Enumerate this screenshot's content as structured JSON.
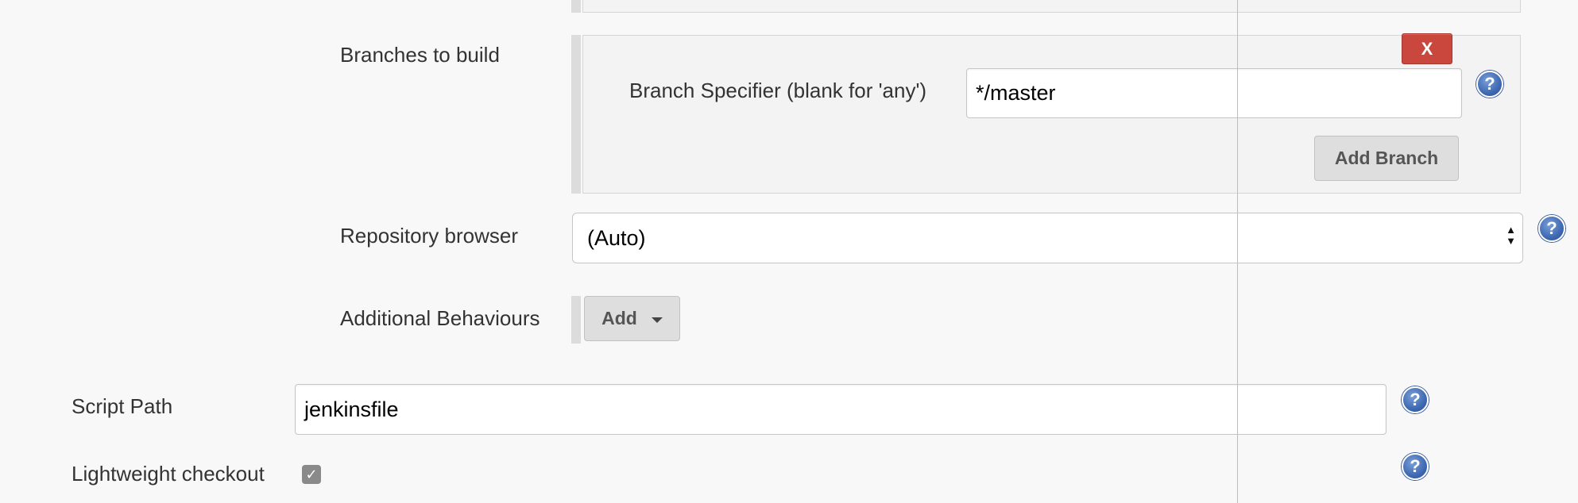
{
  "scm_git": {
    "branches": {
      "label": "Branches to build",
      "delete_label": "X",
      "specifier_label": "Branch Specifier (blank for 'any')",
      "specifier_value": "*/master",
      "add_branch_label": "Add Branch",
      "help_glyph": "?"
    },
    "repository_browser": {
      "label": "Repository browser",
      "selected": "(Auto)",
      "arrow_up": "▲",
      "arrow_down": "▼",
      "help_glyph": "?"
    },
    "additional_behaviours": {
      "label": "Additional Behaviours",
      "add_label": "Add"
    }
  },
  "script_path": {
    "label": "Script Path",
    "value": "jenkinsfile",
    "help_glyph": "?"
  },
  "lightweight_checkout": {
    "label": "Lightweight checkout",
    "checked": true,
    "check_glyph": "✓",
    "help_glyph": "?"
  },
  "colors": {
    "delete_button": "#c9473c",
    "help_icon": "#3f69b3",
    "panel_bg": "#f3f3f3",
    "page_bg": "#f8f8f8"
  },
  "icons": [
    "help-icon",
    "dropdown-caret-icon",
    "select-arrows-icon",
    "checkmark-icon"
  ]
}
